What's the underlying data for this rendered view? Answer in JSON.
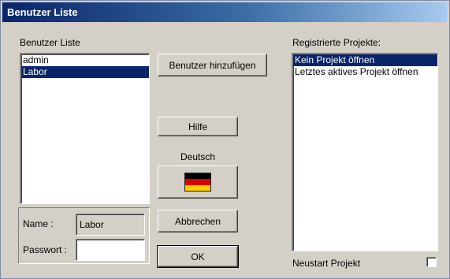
{
  "window": {
    "title": "Benutzer Liste"
  },
  "users": {
    "label": "Benutzer Liste",
    "items": [
      "admin",
      "Labor"
    ],
    "selected": "Labor"
  },
  "buttons": {
    "add_user": "Benutzer hinzufügen",
    "help": "Hilfe",
    "cancel": "Abbrechen",
    "ok": "OK"
  },
  "language": {
    "label": "Deutsch",
    "flag_icon": "german-flag-icon",
    "flag_colors": [
      "#000000",
      "#dd0000",
      "#ffce00"
    ]
  },
  "login": {
    "name_label": "Name :",
    "name_value": "Labor",
    "password_label": "Passwort :",
    "password_value": ""
  },
  "projects": {
    "label": "Registrierte Projekte:",
    "items": [
      "Kein Projekt öffnen",
      "Letztes aktives Projekt öffnen"
    ],
    "selected": "Kein Projekt öffnen"
  },
  "restart": {
    "label": "Neustart Projekt",
    "checked": false
  }
}
